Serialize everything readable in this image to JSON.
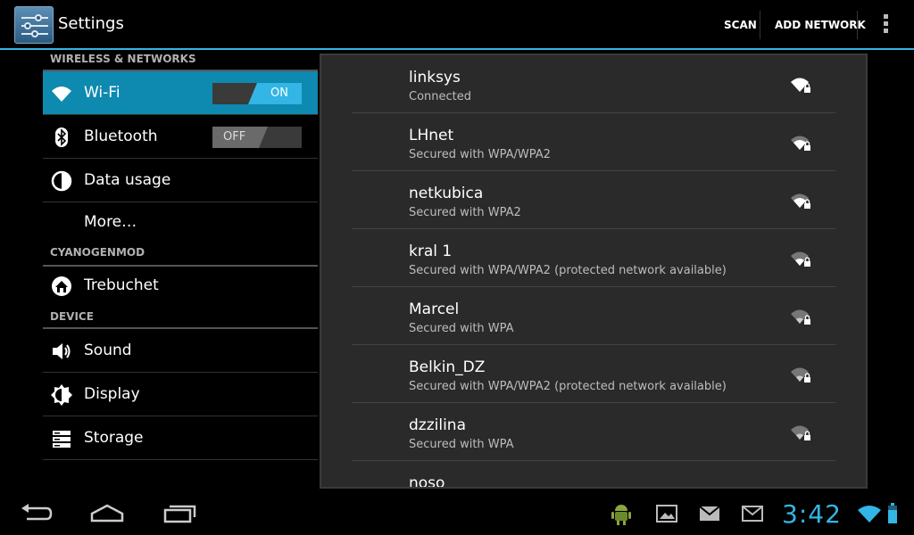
{
  "app": {
    "title": "Settings"
  },
  "actions": {
    "scan": "SCAN",
    "add_network": "ADD NETWORK"
  },
  "sections": [
    {
      "header": "WIRELESS & NETWORKS"
    },
    {
      "header": "CYANOGENMOD"
    },
    {
      "header": "DEVICE"
    }
  ],
  "items": {
    "wifi": {
      "label": "Wi-Fi",
      "toggle": "ON"
    },
    "bluetooth": {
      "label": "Bluetooth",
      "toggle": "OFF"
    },
    "data_usage": {
      "label": "Data usage"
    },
    "more": {
      "label": "More…"
    },
    "trebuchet": {
      "label": "Trebuchet"
    },
    "sound": {
      "label": "Sound"
    },
    "display": {
      "label": "Display"
    },
    "storage": {
      "label": "Storage"
    }
  },
  "networks": [
    {
      "name": "linksys",
      "status": "Connected"
    },
    {
      "name": "LHnet",
      "status": "Secured with WPA/WPA2"
    },
    {
      "name": "netkubica",
      "status": "Secured with WPA2"
    },
    {
      "name": "kral 1",
      "status": "Secured with WPA/WPA2 (protected network available)"
    },
    {
      "name": "Marcel",
      "status": "Secured with WPA"
    },
    {
      "name": "Belkin_DZ",
      "status": "Secured with WPA/WPA2 (protected network available)"
    },
    {
      "name": "dzzilina",
      "status": "Secured with WPA"
    },
    {
      "name": "noso",
      "status": ""
    }
  ],
  "statusbar": {
    "time": "3:42"
  },
  "colors": {
    "accent": "#33b5e5",
    "selected": "#0e89b0"
  }
}
